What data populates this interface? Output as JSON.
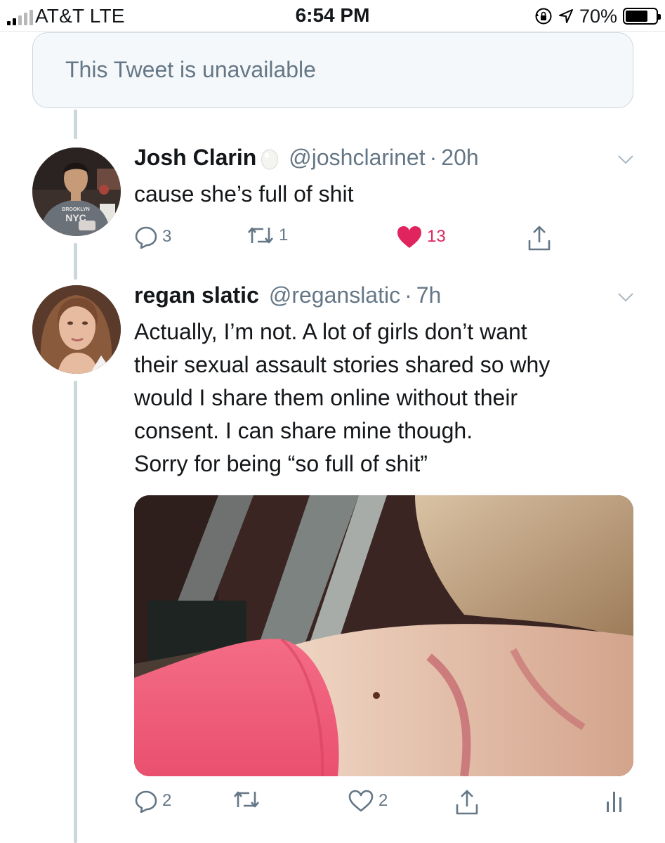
{
  "status_bar": {
    "carrier": "AT&T  LTE",
    "time": "6:54 PM",
    "battery_percent": "70%",
    "battery_level": 0.7,
    "signal_bars": 2,
    "icons": [
      "rotation-lock-icon",
      "location-arrow-icon",
      "battery-icon"
    ]
  },
  "unavailable_notice": "This Tweet is unavailable",
  "tweets": [
    {
      "name": "Josh Clarin",
      "handle": "@joshclarinet",
      "separator": "·",
      "time": "20h",
      "text": [
        "cause she’s full of shit"
      ],
      "actions": {
        "replies": "3",
        "retweets": "1",
        "likes": "13",
        "liked": true
      }
    },
    {
      "name": "regan slatic",
      "handle": "@reganslatic",
      "separator": "·",
      "time": "7h",
      "text": [
        "Actually, I’m not. A lot of girls don’t want",
        "their sexual assault stories shared so why",
        "would I share them online without their",
        "consent. I can share mine though.",
        "Sorry for being “so full of shit”"
      ],
      "media": "photo",
      "actions": {
        "replies": "2",
        "retweets": "",
        "likes": "2",
        "liked": false
      }
    }
  ],
  "colors": {
    "secondary": "#657786",
    "like": "#e0245e",
    "border": "#ccd6dd"
  }
}
